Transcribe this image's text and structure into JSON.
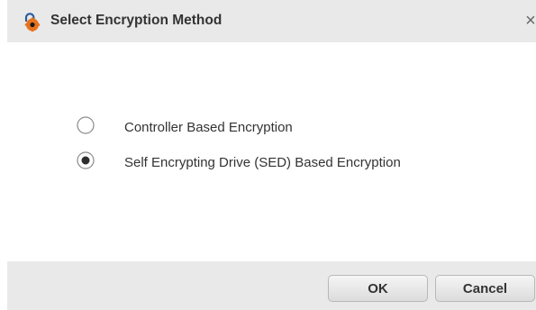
{
  "dialog": {
    "title": "Select Encryption Method",
    "icon": "unlock-gear-icon",
    "close_label": "×",
    "accent_color": "#e8721c"
  },
  "options": [
    {
      "label": "Controller Based Encryption",
      "selected": false
    },
    {
      "label": "Self Encrypting Drive (SED) Based Encryption",
      "selected": true
    }
  ],
  "footer": {
    "ok_label": "OK",
    "cancel_label": "Cancel"
  }
}
